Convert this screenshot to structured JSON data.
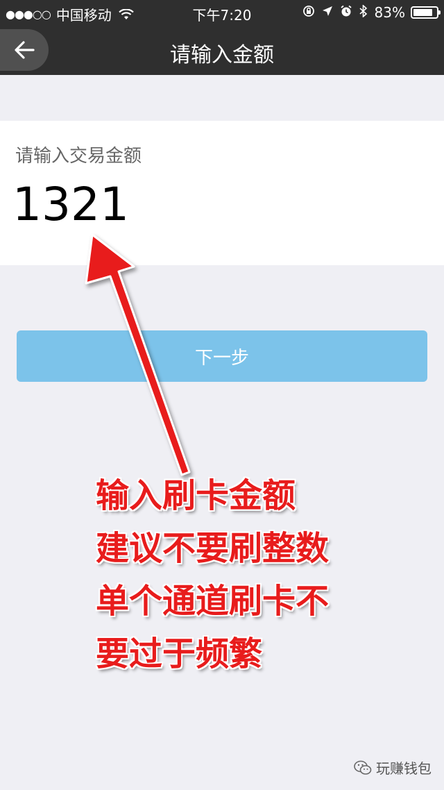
{
  "status_bar": {
    "signal": "●●●○○",
    "carrier": "中国移动",
    "wifi_icon": "wifi-icon",
    "time": "下午7:20",
    "icons": [
      "orientation-lock-icon",
      "location-icon",
      "alarm-icon",
      "bluetooth-icon"
    ],
    "battery_percent": "83%",
    "battery_level": 0.83
  },
  "nav": {
    "back_icon": "back-arrow-icon",
    "title": "请输入金额"
  },
  "amount": {
    "label": "请输入交易金额",
    "value": "1321"
  },
  "next_button": {
    "label": "下一步",
    "color": "#7cc3ea"
  },
  "annotation": {
    "lines": [
      "输入刷卡金额",
      "建议不要刷整数",
      "单个通道刷卡不",
      "要过于频繁"
    ],
    "color": "#e81c1c"
  },
  "watermark": {
    "text": "玩赚钱包"
  }
}
